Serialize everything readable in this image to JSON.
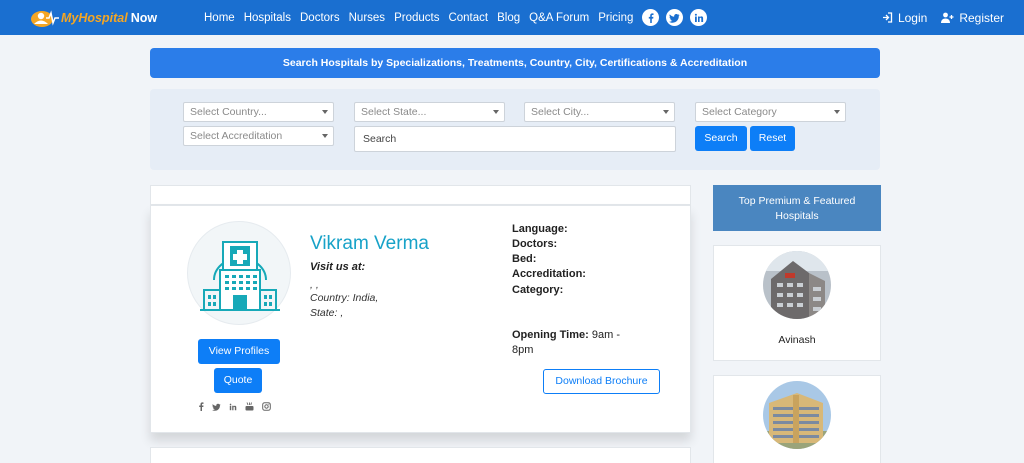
{
  "brand": {
    "name": "MyHospital",
    "suffix": "Now"
  },
  "nav": {
    "links": [
      "Home",
      "Hospitals",
      "Doctors",
      "Nurses",
      "Products",
      "Contact",
      "Blog",
      "Q&A Forum",
      "Pricing"
    ],
    "login": "Login",
    "register": "Register"
  },
  "search": {
    "banner": "Search Hospitals by Specializations, Treatments, Country, City, Certifications & Accreditation",
    "country": "Select Country...",
    "state": "Select State...",
    "city": "Select City...",
    "category": "Select Category",
    "accreditation": "Select Accreditation",
    "query_placeholder": "Search",
    "search_button": "Search",
    "reset_button": "Reset"
  },
  "hospital": {
    "name": "Vikram Verma",
    "visit_label": "Visit us at:",
    "address_line": ", ,",
    "country_line": "Country: India,",
    "state_line": "State: ,",
    "language_label": "Language:",
    "doctors_label": "Doctors:",
    "bed_label": "Bed:",
    "accreditation_label": "Accreditation:",
    "category_label": "Category:",
    "opening_label": "Opening Time:",
    "opening_value_1": "9am -",
    "opening_value_2": "8pm",
    "view_profiles": "View Profiles",
    "quote": "Quote",
    "brochure": "Download Brochure"
  },
  "sidebar": {
    "title_line1": "Top Premium & Featured",
    "title_line2": "Hospitals",
    "items": [
      {
        "name": "Avinash"
      }
    ]
  },
  "colors": {
    "navbar": "#1a6fd0",
    "accent": "#0d7ef7",
    "name": "#17a2c8",
    "sidebar_head": "#4a86c0"
  }
}
